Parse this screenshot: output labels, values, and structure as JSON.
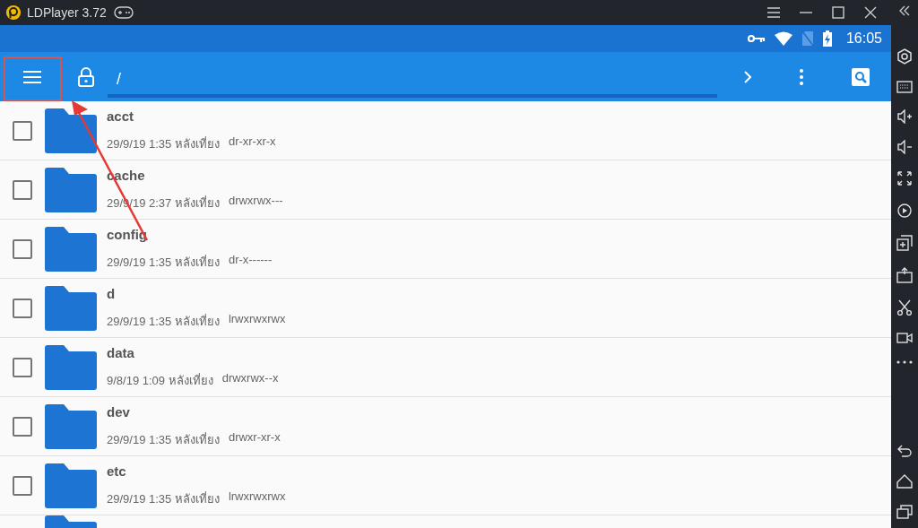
{
  "window": {
    "title": "LDPlayer 3.72"
  },
  "status_bar": {
    "time": "16:05"
  },
  "toolbar": {
    "path": "/"
  },
  "files": [
    {
      "name": "acct",
      "date": "29/9/19 1:35 หลังเที่ยง",
      "permissions": "dr-xr-xr-x",
      "checked": false
    },
    {
      "name": "cache",
      "date": "29/9/19 2:37 หลังเที่ยง",
      "permissions": "drwxrwx---",
      "checked": false
    },
    {
      "name": "config",
      "date": "29/9/19 1:35 หลังเที่ยง",
      "permissions": "dr-x------",
      "checked": false
    },
    {
      "name": "d",
      "date": "29/9/19 1:35 หลังเที่ยง",
      "permissions": "lrwxrwxrwx",
      "checked": false
    },
    {
      "name": "data",
      "date": "9/8/19 1:09 หลังเที่ยง",
      "permissions": "drwxrwx--x",
      "checked": false
    },
    {
      "name": "dev",
      "date": "29/9/19 1:35 หลังเที่ยง",
      "permissions": "drwxr-xr-x",
      "checked": false
    },
    {
      "name": "etc",
      "date": "29/9/19 1:35 หลังเที่ยง",
      "permissions": "lrwxrwxrwx",
      "checked": false
    }
  ]
}
